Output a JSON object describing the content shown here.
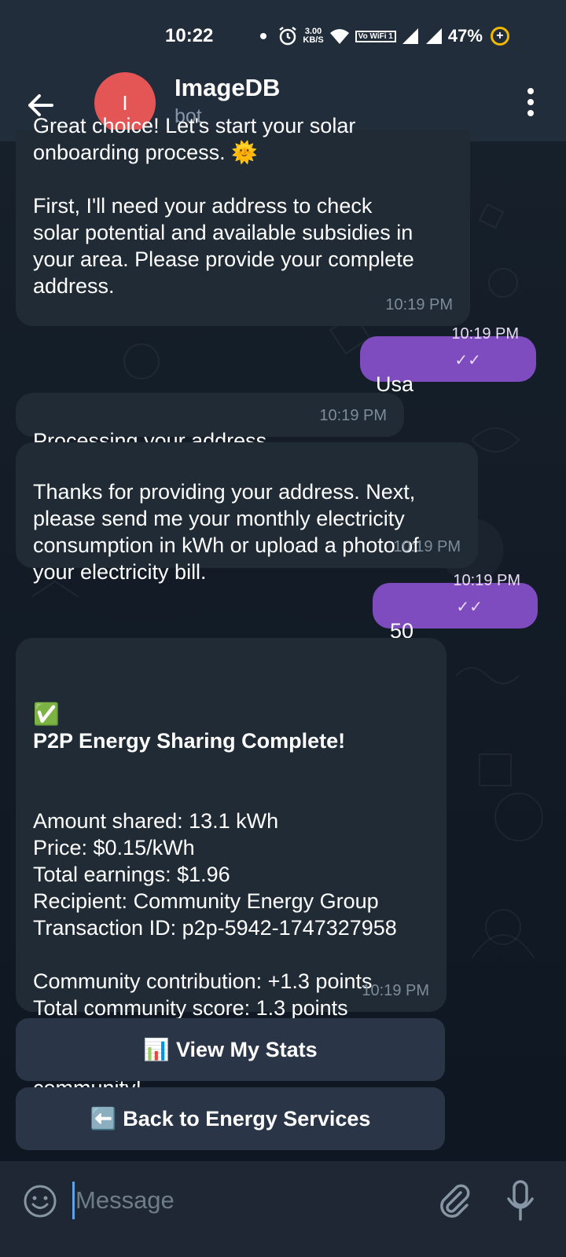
{
  "status_bar": {
    "time": "10:22",
    "net_speed": "3.00",
    "net_unit": "KB/S",
    "wifi_label": "Vo WiFi 1",
    "battery": "47%"
  },
  "header": {
    "avatar_letter": "I",
    "title": "ImageDB",
    "subtitle": "bot"
  },
  "messages": [
    {
      "direction": "in",
      "text": "Great choice! Let's start your solar\nonboarding process. 🌞\n\nFirst, I'll need your address to check\nsolar potential and available subsidies in\nyour area. Please provide your complete\naddress.",
      "time": "10:19 PM"
    },
    {
      "direction": "out",
      "text": "Usa",
      "time": "10:19 PM",
      "ticks": "✓✓"
    },
    {
      "direction": "in",
      "text": "Processing your address...",
      "time": "10:19 PM"
    },
    {
      "direction": "in",
      "text": "Thanks for providing your address. Next,\nplease send me your monthly electricity\nconsumption in kWh or upload a photo of\nyour electricity bill.",
      "time": "10:19 PM"
    },
    {
      "direction": "out",
      "text": "50",
      "time": "10:19 PM",
      "ticks": "✓✓"
    },
    {
      "direction": "in",
      "title_emoji": "✅",
      "title": "P2P Energy Sharing Complete!",
      "text": "Amount shared: 13.1 kWh\nPrice: $0.15/kWh\nTotal earnings: $1.96\nRecipient: Community Energy Group\nTransaction ID: p2p-5942-1747327958\n\nCommunity contribution: +1.3 points\nTotal community score: 1.3 points\n\nThank you for sharing with your\ncommunity!",
      "time": "10:19 PM"
    }
  ],
  "keyboard": [
    {
      "icon": "📊",
      "label": "View My Stats"
    },
    {
      "icon": "⬅️",
      "label": "Back to Energy Services"
    }
  ],
  "input": {
    "placeholder": "Message"
  },
  "colors": {
    "header_bg": "#222d3b",
    "incoming_bubble": "#202b36",
    "outgoing_bubble": "#7f4cc0",
    "avatar": "#e45656"
  }
}
